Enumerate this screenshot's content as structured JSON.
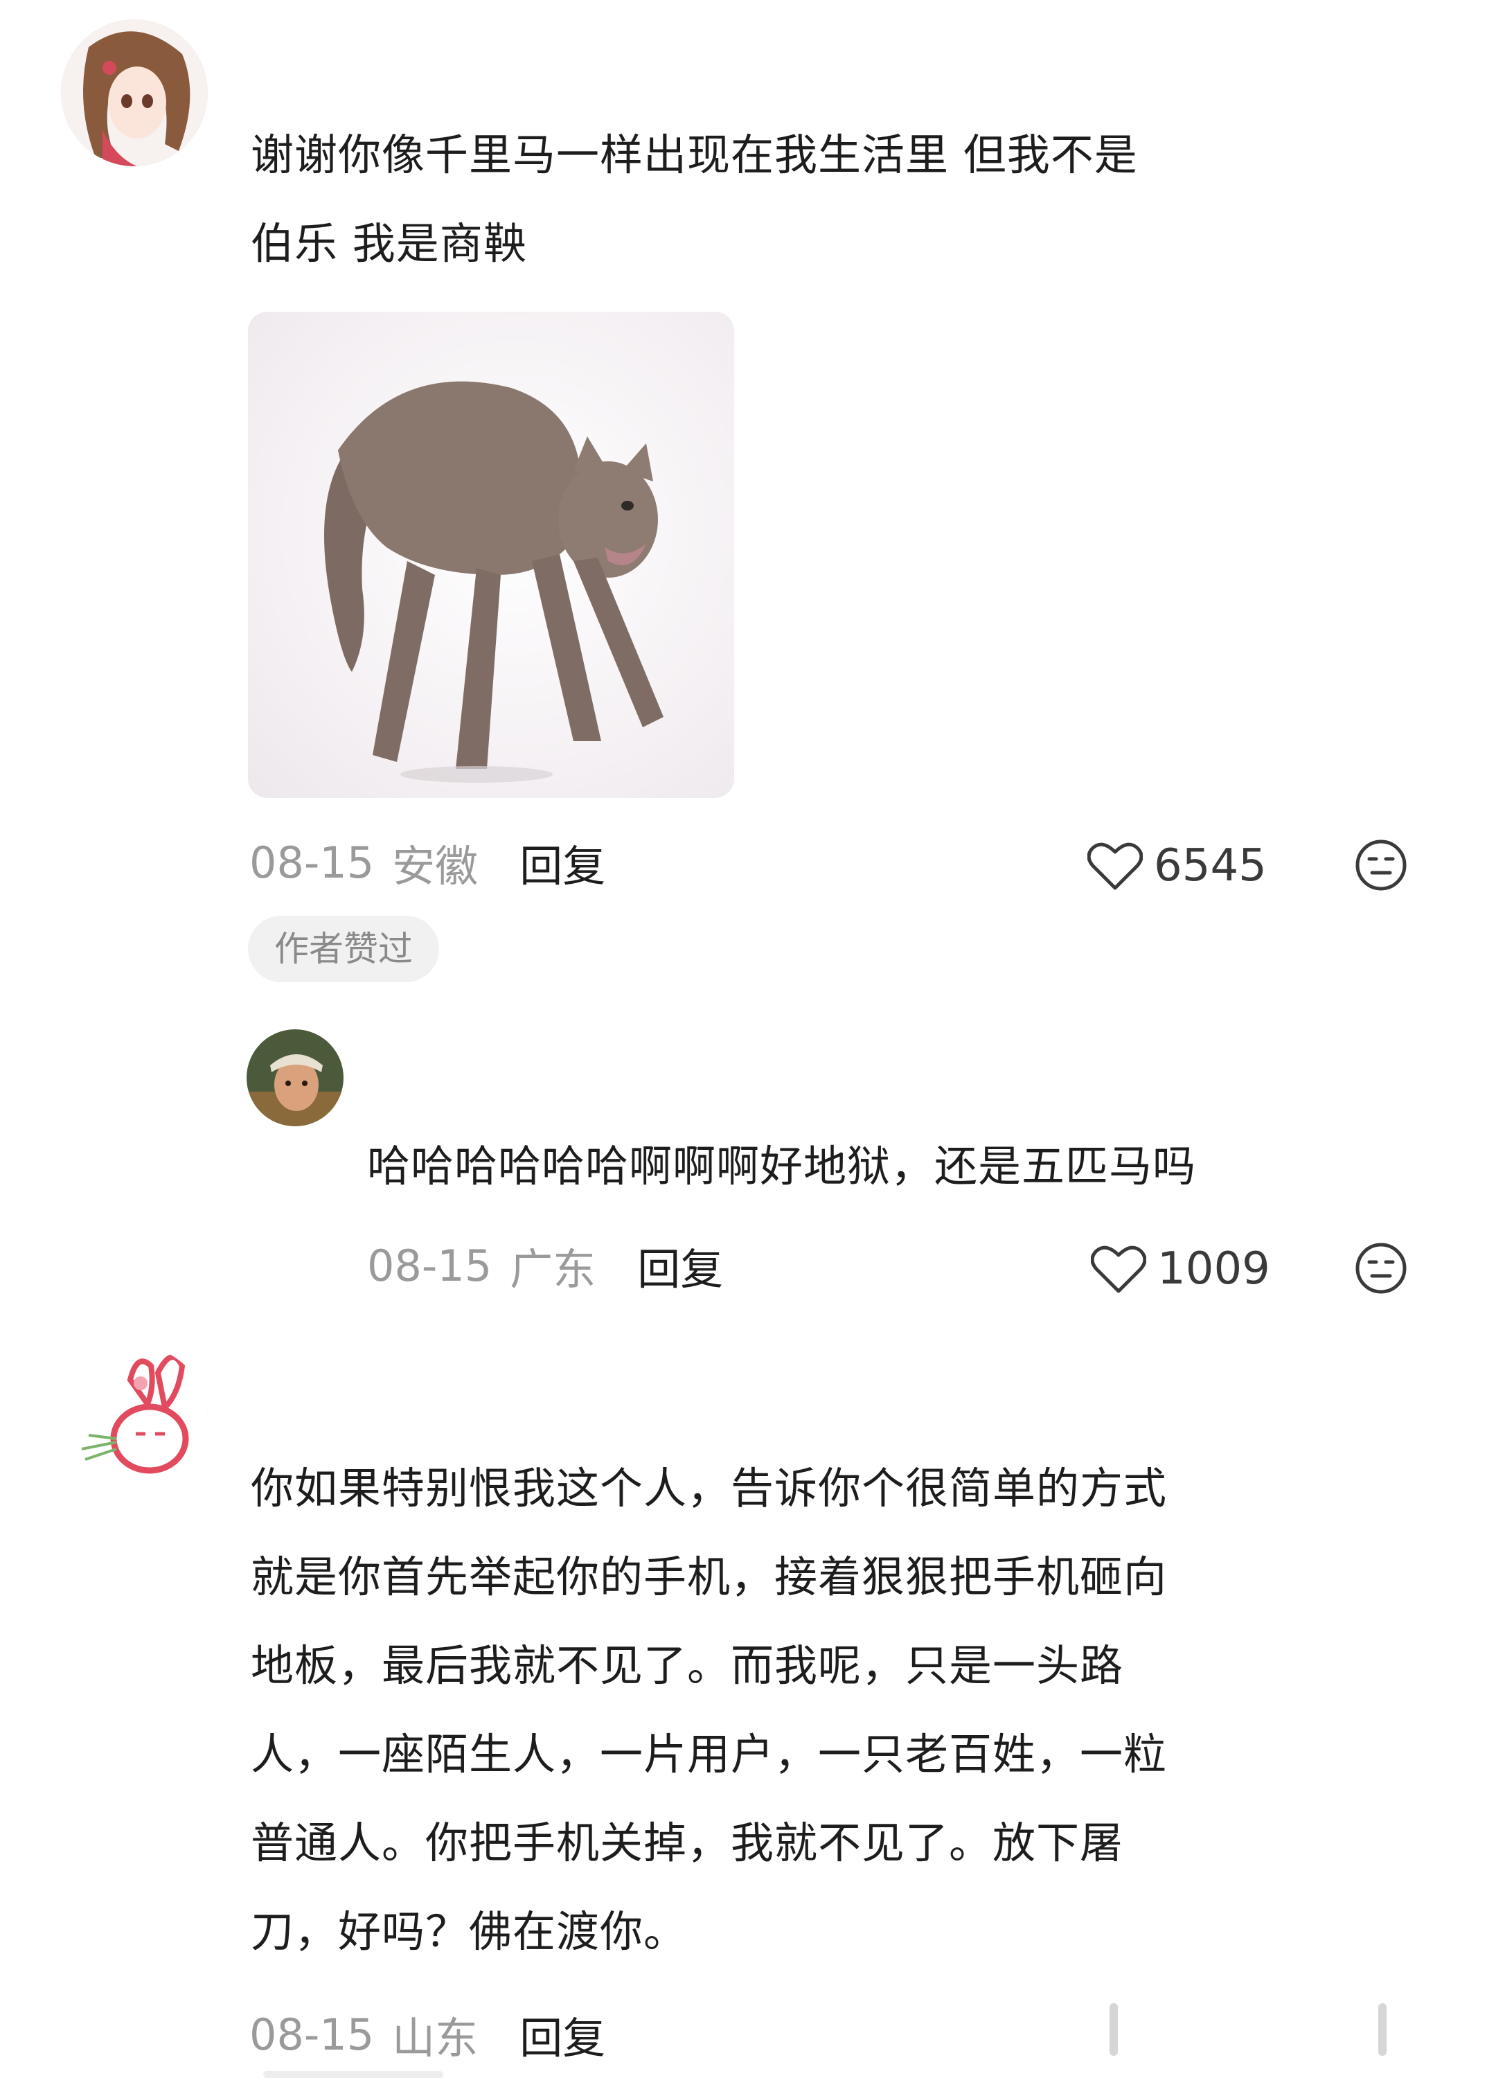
{
  "comments": [
    {
      "text_line1": "谢谢你像千里马一样出现在我生活里 但我不是",
      "text_line2": "伯乐 我是商鞅",
      "date": "08-15",
      "location": "安徽",
      "reply_label": "回复",
      "likes": "6545",
      "badge": "作者赞过",
      "avatar_icon": "anime-girl-avatar",
      "image_icon": "scared-cat-image"
    },
    {
      "text": "哈哈哈哈哈哈啊啊啊好地狱，还是五匹马吗",
      "date": "08-15",
      "location": "广东",
      "reply_label": "回复",
      "likes": "1009",
      "avatar_icon": "person-avatar"
    },
    {
      "lines": [
        "你如果特别恨我这个人，告诉你个很简单的方式",
        "就是你首先举起你的手机，接着狠狠把手机砸向",
        "地板，最后我就不见了。而我呢，只是一头路",
        "人，一座陌生人，一片用户，一只老百姓，一粒",
        "普通人。你把手机关掉，我就不见了。放下屠",
        "刀，好吗？佛在渡你。"
      ],
      "date": "08-15",
      "location": "山东",
      "reply_label": "回复",
      "avatar_icon": "rabbit-avatar"
    }
  ],
  "colors": {
    "text": "#1d1d1d",
    "meta": "#9a9a9a",
    "badge_bg": "#f1f1f1"
  }
}
